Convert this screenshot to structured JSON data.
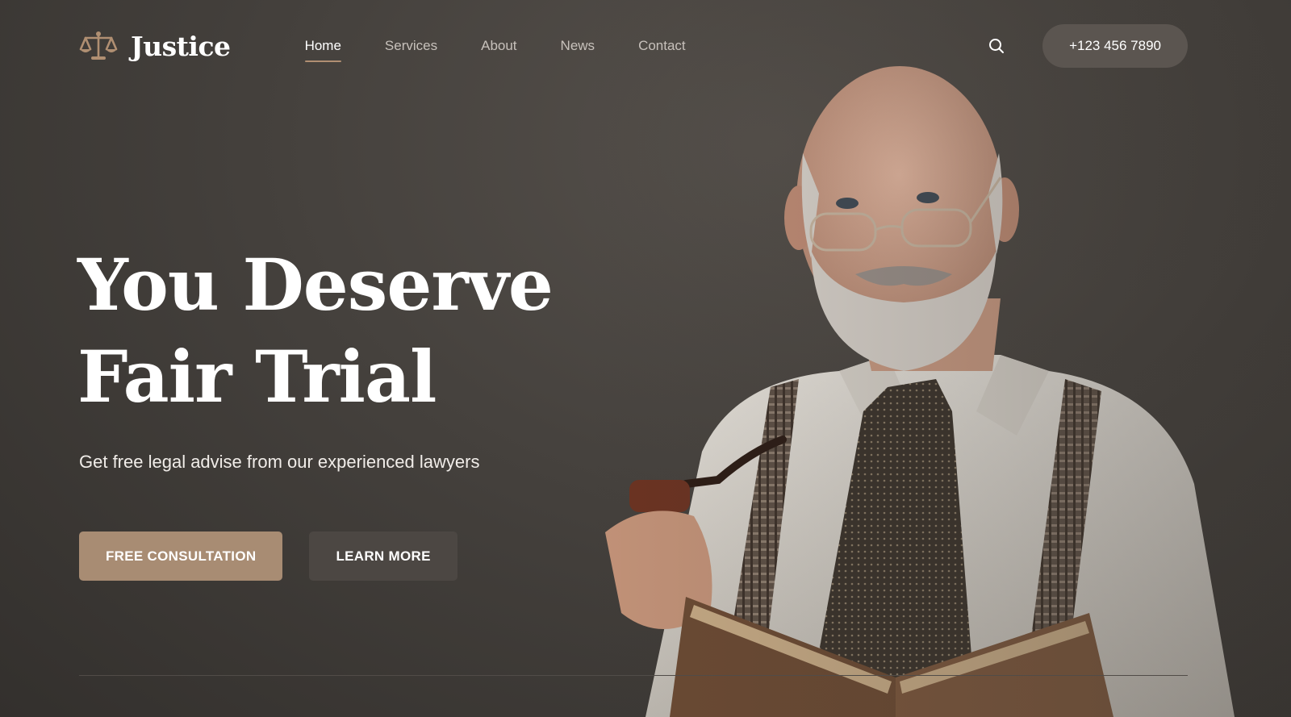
{
  "brand": {
    "name": "Justice",
    "logo_icon": "scales-icon",
    "accent": "#a88c73"
  },
  "nav": {
    "items": [
      {
        "label": "Home",
        "active": true
      },
      {
        "label": "Services",
        "active": false
      },
      {
        "label": "About",
        "active": false
      },
      {
        "label": "News",
        "active": false
      },
      {
        "label": "Contact",
        "active": false
      }
    ]
  },
  "header": {
    "search_icon": "search-icon",
    "phone_label": "+123 456 7890"
  },
  "hero": {
    "title_line1": "You Deserve",
    "title_line2": "Fair Trial",
    "subtitle": "Get free legal advise from our experienced lawyers",
    "primary_button": "FREE CONSULTATION",
    "secondary_button": "LEARN MORE"
  },
  "colors": {
    "background": "#45413d",
    "button_secondary": "#4c4743",
    "phone_button": "#5b5550"
  }
}
